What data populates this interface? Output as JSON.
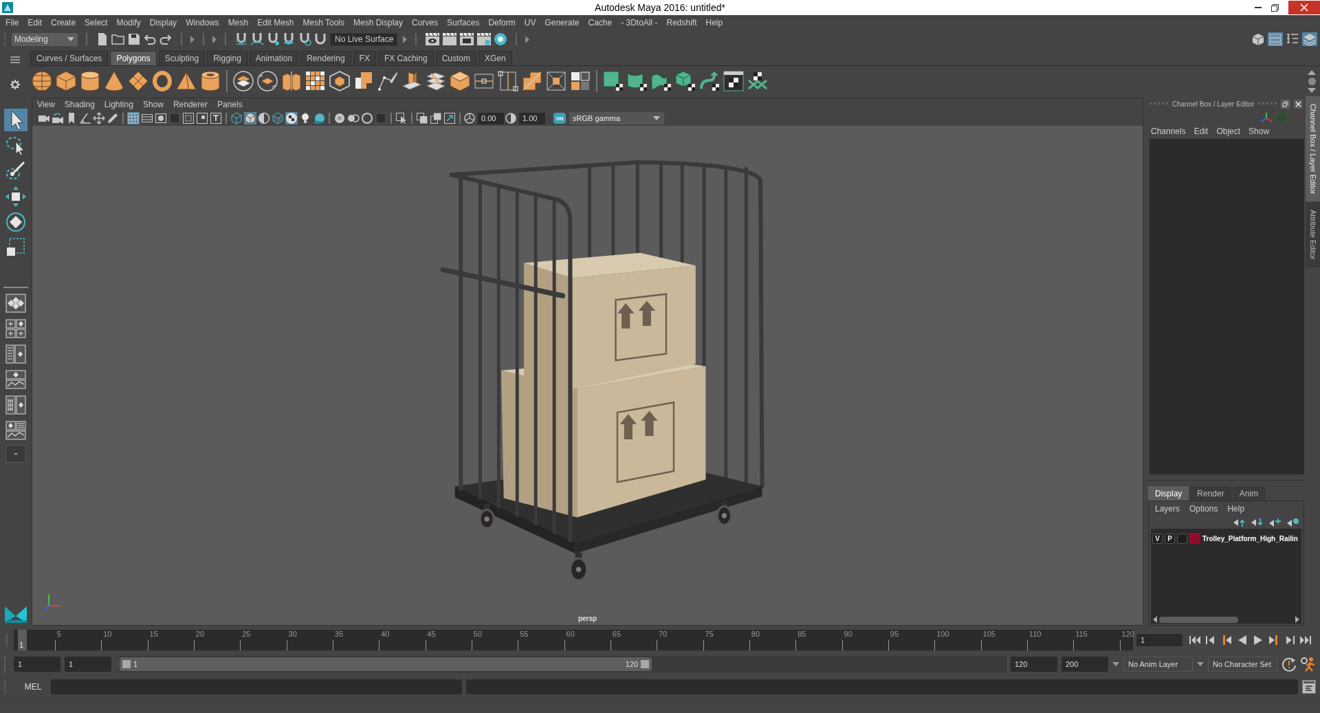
{
  "window": {
    "title": "Autodesk Maya 2016: untitled*"
  },
  "menu_bar": [
    "File",
    "Edit",
    "Create",
    "Select",
    "Modify",
    "Display",
    "Windows",
    "Mesh",
    "Edit Mesh",
    "Mesh Tools",
    "Mesh Display",
    "Curves",
    "Surfaces",
    "Deform",
    "UV",
    "Generate",
    "Cache",
    "- 3DtoAll -",
    "Redshift",
    "Help"
  ],
  "status_line": {
    "menu_set": "Modeling",
    "live_surface": "No Live Surface",
    "panel_toggles": [
      {
        "on": false
      },
      {
        "on": true
      },
      {
        "on": false
      },
      {
        "on": true
      }
    ]
  },
  "shelf": {
    "tabs": [
      {
        "label": "Curves / Surfaces",
        "selected": false
      },
      {
        "label": "Polygons",
        "selected": true
      },
      {
        "label": "Sculpting",
        "selected": false
      },
      {
        "label": "Rigging",
        "selected": false
      },
      {
        "label": "Animation",
        "selected": false
      },
      {
        "label": "Rendering",
        "selected": false
      },
      {
        "label": "FX",
        "selected": false
      },
      {
        "label": "FX Caching",
        "selected": false
      },
      {
        "label": "Custom",
        "selected": false
      },
      {
        "label": "XGen",
        "selected": false
      }
    ]
  },
  "tool_box": {
    "tools": [
      {
        "selected": true
      },
      {
        "selected": false
      },
      {
        "selected": false
      },
      {
        "selected": false
      },
      {
        "selected": false
      },
      {
        "selected": false
      }
    ]
  },
  "viewport": {
    "menu": [
      "View",
      "Shading",
      "Lighting",
      "Show",
      "Renderer",
      "Panels"
    ],
    "toolbar_toggles": [
      {
        "on": false
      },
      {
        "on": false
      },
      {
        "on": false
      },
      {
        "on": false
      },
      {
        "on": false
      },
      {
        "on": false
      },
      {
        "on": true
      },
      {
        "on": false
      },
      {
        "on": false
      },
      {
        "on": false
      },
      {
        "on": false
      },
      {
        "on": false
      },
      {
        "on": false
      },
      {
        "on": false
      },
      {
        "on": true
      },
      {
        "on": false
      },
      {
        "on": false
      },
      {
        "on": true
      },
      {
        "on": false
      },
      {
        "on": false
      },
      {
        "on": false
      },
      {
        "on": false
      },
      {
        "on": false
      },
      {
        "on": false
      },
      {
        "on": false
      },
      {
        "on": false
      },
      {
        "on": false
      },
      {
        "on": false
      }
    ],
    "exposure": "0.00",
    "gamma": "1.00",
    "color_management": "ON",
    "color_space": "sRGB gamma",
    "camera": "persp"
  },
  "channel_box": {
    "title": "Channel Box / Layer Editor",
    "menu": [
      "Channels",
      "Edit",
      "Object",
      "Show"
    ]
  },
  "layer_editor": {
    "tabs": [
      {
        "label": "Display",
        "selected": true
      },
      {
        "label": "Render",
        "selected": false
      },
      {
        "label": "Anim",
        "selected": false
      }
    ],
    "menu": [
      "Layers",
      "Options",
      "Help"
    ],
    "layers": [
      {
        "visibility": "V",
        "playback": "P",
        "color": "#900c2a",
        "name": "Trolley_Platform_High_Railin"
      }
    ]
  },
  "side_tabs": [
    {
      "label": "Channel Box / Layer Editor",
      "selected": true
    },
    {
      "label": "Attribute Editor",
      "selected": false
    }
  ],
  "time_slider": {
    "level": 0,
    "current_frame": "1",
    "frame_labels": [
      "5",
      "10",
      "15",
      "20",
      "25",
      "30",
      "35",
      "40",
      "45",
      "50",
      "55",
      "60",
      "65",
      "70",
      "75",
      "80",
      "85",
      "90",
      "95",
      "100",
      "105",
      "110",
      "115",
      "120"
    ],
    "current_frame_field": "1"
  },
  "range_slider": {
    "start_time": "1",
    "playback_start": "1",
    "range_start": "1",
    "range_end": "120",
    "level": 0.6,
    "playback_end": "120",
    "end_time": "200",
    "anim_layer": "No Anim Layer",
    "character_set": "No Character Set"
  },
  "command_line": {
    "language": "MEL"
  }
}
